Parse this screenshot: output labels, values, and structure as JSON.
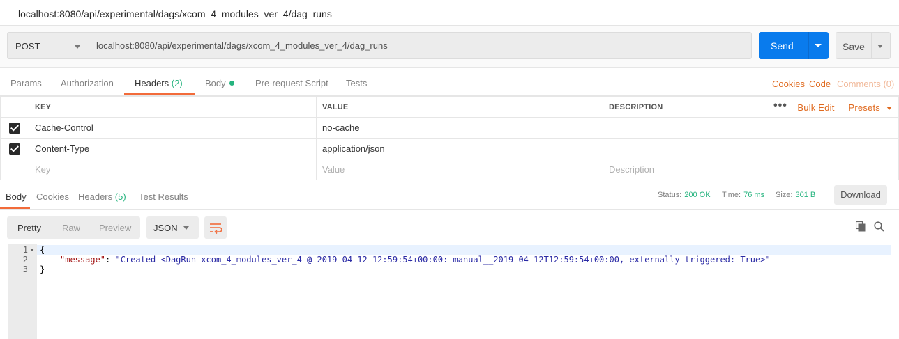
{
  "title_bar": {
    "title": "localhost:8080/api/experimental/dags/xcom_4_modules_ver_4/dag_runs"
  },
  "request": {
    "method": "POST",
    "url": "localhost:8080/api/experimental/dags/xcom_4_modules_ver_4/dag_runs",
    "send_label": "Send",
    "save_label": "Save"
  },
  "request_tabs": {
    "params": "Params",
    "authorization": "Authorization",
    "headers": "Headers",
    "headers_count": "(2)",
    "body": "Body",
    "pre_request": "Pre-request Script",
    "tests": "Tests",
    "cookies": "Cookies",
    "code": "Code",
    "comments": "Comments (0)"
  },
  "headers_table": {
    "columns": {
      "key": "KEY",
      "value": "VALUE",
      "description": "DESCRIPTION"
    },
    "ellipsis": "•••",
    "bulk_edit": "Bulk Edit",
    "presets": "Presets",
    "rows": [
      {
        "key": "Cache-Control",
        "value": "no-cache",
        "description": ""
      },
      {
        "key": "Content-Type",
        "value": "application/json",
        "description": ""
      }
    ],
    "placeholders": {
      "key": "Key",
      "value": "Value",
      "description": "Description"
    }
  },
  "response_tabs": {
    "body": "Body",
    "cookies": "Cookies",
    "headers": "Headers",
    "headers_count": "(5)",
    "test_results": "Test Results",
    "status_label": "Status:",
    "status_value": "200 OK",
    "time_label": "Time:",
    "time_value": "76 ms",
    "size_label": "Size:",
    "size_value": "301 B",
    "download": "Download"
  },
  "viewer": {
    "modes": [
      "Pretty",
      "Raw",
      "Preview"
    ],
    "active_mode": "Pretty",
    "format": "JSON"
  },
  "response_body": {
    "line_numbers": [
      "1",
      "2",
      "3"
    ],
    "open_brace": "{",
    "key": "\"message\"",
    "colon": ": ",
    "value": "\"Created <DagRun xcom_4_modules_ver_4 @ 2019-04-12 12:59:54+00:00: manual__2019-04-12T12:59:54+00:00, externally triggered: True>\"",
    "close_brace": "}"
  },
  "colors": {
    "send_blue": "#097bed",
    "accent_orange": "#f26b3a",
    "status_green": "#26b47f"
  }
}
